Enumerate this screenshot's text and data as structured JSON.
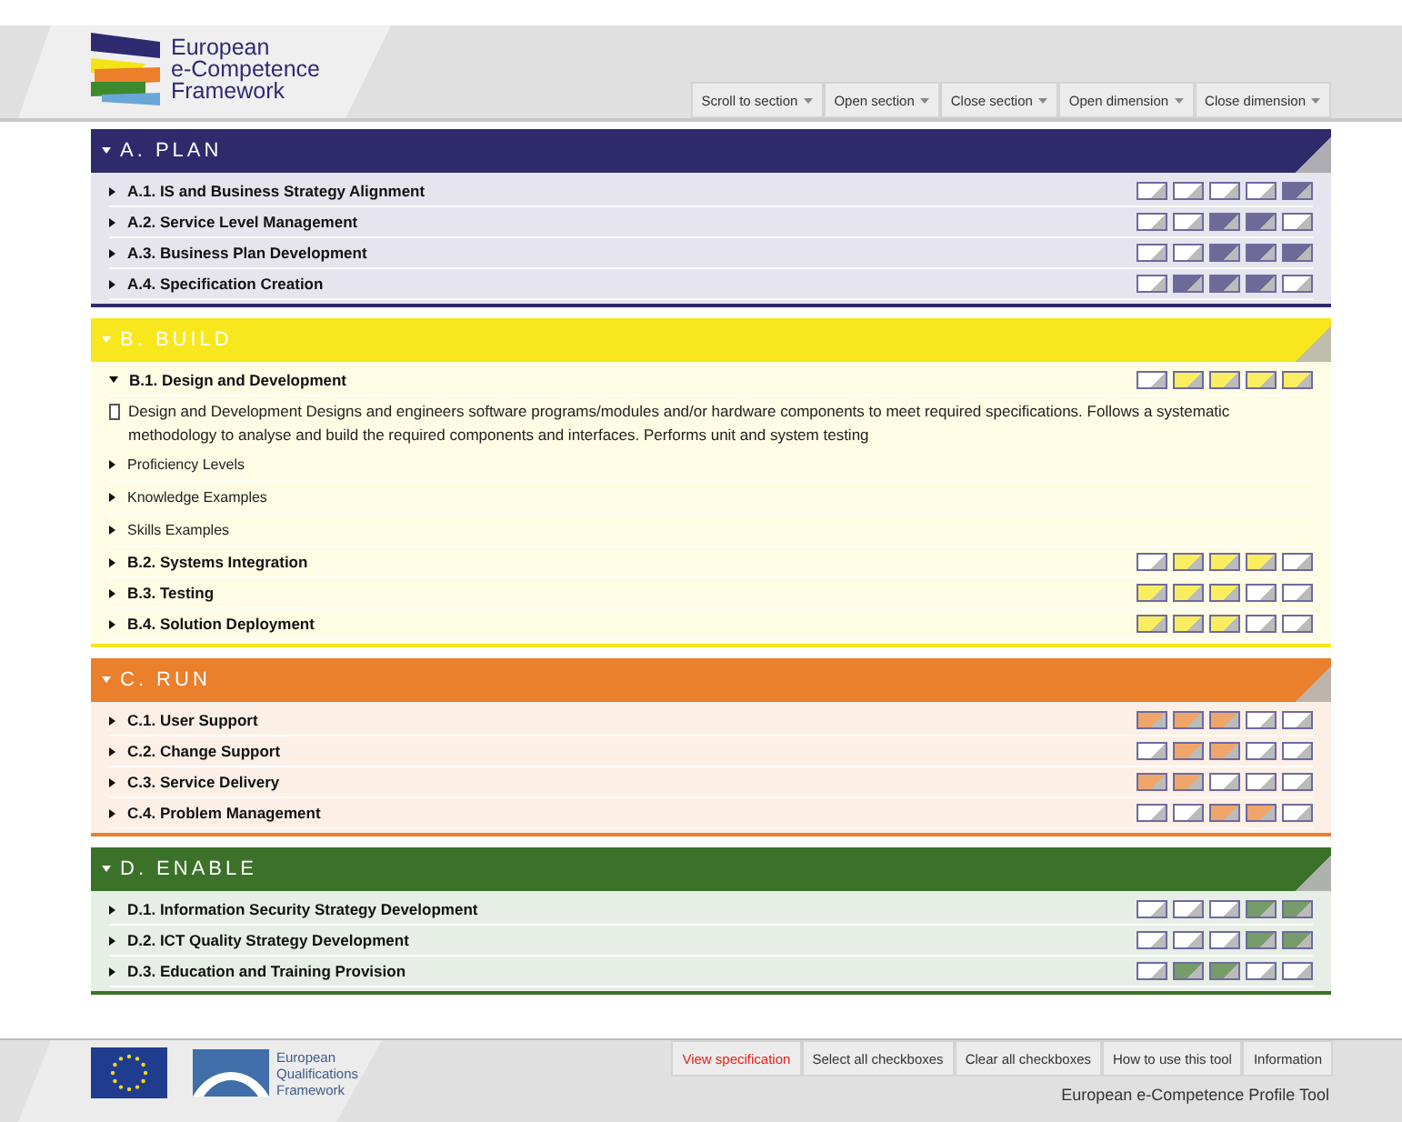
{
  "header": {
    "logo_lines": [
      "European",
      "e-Competence",
      "Framework"
    ],
    "buttons": [
      "Scroll to section",
      "Open section",
      "Close section",
      "Open dimension",
      "Close dimension"
    ]
  },
  "sections": [
    {
      "title": "A. PLAN",
      "expanded": true,
      "color": "#2f2a6b",
      "rows": [
        {
          "label": "A.1. IS and Business Strategy Alignment",
          "expanded": false,
          "levels": [
            {
              "filled": false
            },
            {
              "filled": false
            },
            {
              "filled": false
            },
            {
              "filled": false
            },
            {
              "filled": true
            }
          ]
        },
        {
          "label": "A.2. Service Level Management",
          "expanded": false,
          "levels": [
            {
              "filled": false
            },
            {
              "filled": false
            },
            {
              "filled": true
            },
            {
              "filled": true
            },
            {
              "filled": false
            }
          ]
        },
        {
          "label": "A.3. Business Plan Development",
          "expanded": false,
          "levels": [
            {
              "filled": false
            },
            {
              "filled": false
            },
            {
              "filled": true
            },
            {
              "filled": true
            },
            {
              "filled": true
            }
          ]
        },
        {
          "label": "A.4. Specification Creation",
          "expanded": false,
          "levels": [
            {
              "filled": false
            },
            {
              "filled": true
            },
            {
              "filled": true
            },
            {
              "filled": true
            },
            {
              "filled": false
            }
          ]
        }
      ]
    },
    {
      "title": "B. BUILD",
      "expanded": true,
      "color": "#f8e71c",
      "rows": [
        {
          "label": "B.1. Design and Development",
          "expanded": true,
          "levels": [
            {
              "filled": false
            },
            {
              "filled": true
            },
            {
              "filled": true
            },
            {
              "filled": true
            },
            {
              "filled": true
            }
          ],
          "description": {
            "checked": false,
            "text": "Design and Development Designs and engineers software programs/modules and/or hardware components to meet required specifications. Follows a systematic methodology to analyse and build the required components and interfaces. Performs unit and system testing"
          },
          "subitems": [
            "Proficiency Levels",
            "Knowledge Examples",
            "Skills Examples"
          ]
        },
        {
          "label": "B.2. Systems Integration",
          "expanded": false,
          "levels": [
            {
              "filled": false
            },
            {
              "filled": true
            },
            {
              "filled": true
            },
            {
              "filled": true
            },
            {
              "filled": false
            }
          ]
        },
        {
          "label": "B.3. Testing",
          "expanded": false,
          "levels": [
            {
              "filled": true
            },
            {
              "filled": true
            },
            {
              "filled": true
            },
            {
              "filled": false
            },
            {
              "filled": false
            }
          ]
        },
        {
          "label": "B.4. Solution Deployment",
          "expanded": false,
          "levels": [
            {
              "filled": true
            },
            {
              "filled": true
            },
            {
              "filled": true
            },
            {
              "filled": false
            },
            {
              "filled": false
            }
          ]
        }
      ]
    },
    {
      "title": "C. RUN",
      "expanded": true,
      "color": "#ea7f2c",
      "rows": [
        {
          "label": "C.1. User Support",
          "expanded": false,
          "levels": [
            {
              "filled": true
            },
            {
              "filled": true
            },
            {
              "filled": true
            },
            {
              "filled": false
            },
            {
              "filled": false
            }
          ]
        },
        {
          "label": "C.2. Change Support",
          "expanded": false,
          "levels": [
            {
              "filled": false
            },
            {
              "filled": true
            },
            {
              "filled": true
            },
            {
              "filled": false
            },
            {
              "filled": false
            }
          ]
        },
        {
          "label": "C.3. Service Delivery",
          "expanded": false,
          "levels": [
            {
              "filled": true
            },
            {
              "filled": true
            },
            {
              "filled": false
            },
            {
              "filled": false
            },
            {
              "filled": false
            }
          ]
        },
        {
          "label": "C.4. Problem Management",
          "expanded": false,
          "levels": [
            {
              "filled": false
            },
            {
              "filled": false
            },
            {
              "filled": true
            },
            {
              "filled": true
            },
            {
              "filled": false
            }
          ]
        }
      ]
    },
    {
      "title": "D. ENABLE",
      "expanded": true,
      "color": "#3b7128",
      "rows": [
        {
          "label": "D.1. Information Security Strategy Development",
          "expanded": false,
          "levels": [
            {
              "filled": false
            },
            {
              "filled": false
            },
            {
              "filled": false
            },
            {
              "filled": true
            },
            {
              "filled": true
            }
          ]
        },
        {
          "label": "D.2. ICT Quality Strategy Development",
          "expanded": false,
          "levels": [
            {
              "filled": false
            },
            {
              "filled": false
            },
            {
              "filled": false
            },
            {
              "filled": true
            },
            {
              "filled": true
            }
          ]
        },
        {
          "label": "D.3. Education and Training Provision",
          "expanded": false,
          "levels": [
            {
              "filled": false
            },
            {
              "filled": true
            },
            {
              "filled": true
            },
            {
              "filled": false
            },
            {
              "filled": false
            }
          ]
        }
      ]
    }
  ],
  "footer": {
    "eqf_lines": [
      "European",
      "Qualifications",
      "Framework"
    ],
    "buttons": [
      {
        "label": "View specification",
        "active": true
      },
      {
        "label": "Select all checkboxes",
        "active": false
      },
      {
        "label": "Clear all checkboxes",
        "active": false
      },
      {
        "label": "How to use this tool",
        "active": false
      },
      {
        "label": "Information",
        "active": false
      }
    ],
    "title": "European e-Competence Profile Tool"
  }
}
